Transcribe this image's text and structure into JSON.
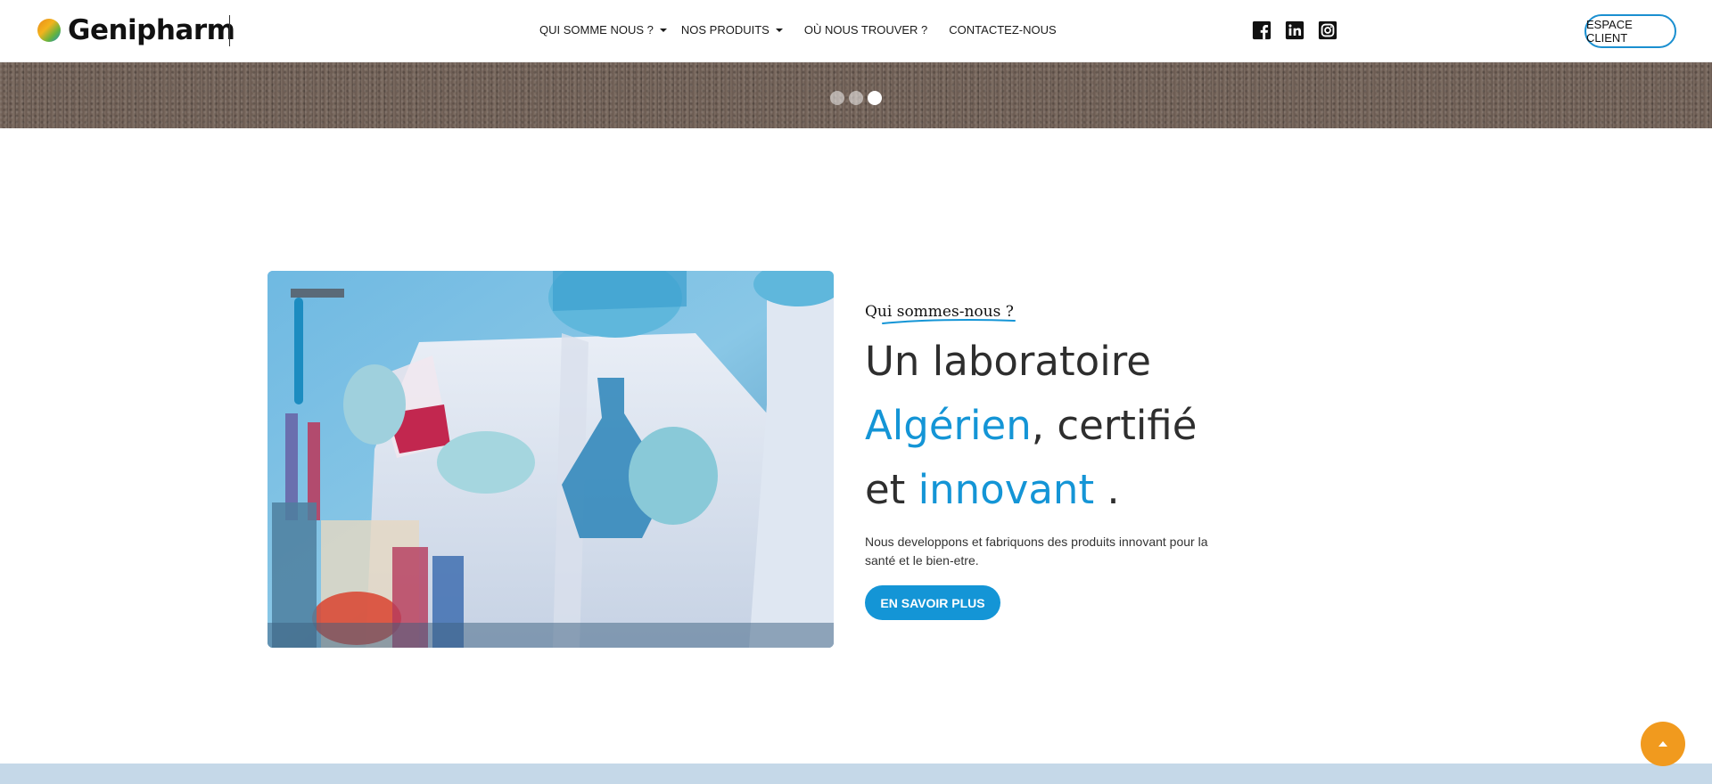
{
  "brand": {
    "name": "Genipharm",
    "accent": "#1495d6",
    "orange": "#f19a1e"
  },
  "nav": {
    "items": [
      {
        "label": "QUI SOMME NOUS ?",
        "dropdown": true
      },
      {
        "label": "NOS PRODUITS",
        "dropdown": true
      },
      {
        "label": "OÙ NOUS TROUVER ?",
        "dropdown": false
      },
      {
        "label": "CONTACTEZ-NOUS",
        "dropdown": false
      }
    ]
  },
  "social": [
    {
      "icon": "facebook-icon"
    },
    {
      "icon": "linkedin-icon"
    },
    {
      "icon": "instagram-icon"
    }
  ],
  "header": {
    "client_button": "ESPACE CLIENT"
  },
  "slider": {
    "dots": 3,
    "active_index": 2
  },
  "about": {
    "eyebrow": "Qui sommes-nous ?",
    "headline": {
      "line1": "Un laboratoire",
      "line2_highlight": "Algérien",
      "line2_rest": ", certifié",
      "line3_prefix": "et ",
      "line3_highlight": "innovant",
      "line3_suffix": " ."
    },
    "description": "Nous developpons et fabriquons des produits innovant pour la santé et le bien-etre.",
    "cta": "EN SAVOIR PLUS",
    "image_icon": "laboratory-photo"
  },
  "scroll_top": {
    "icon": "arrow-up-icon"
  }
}
